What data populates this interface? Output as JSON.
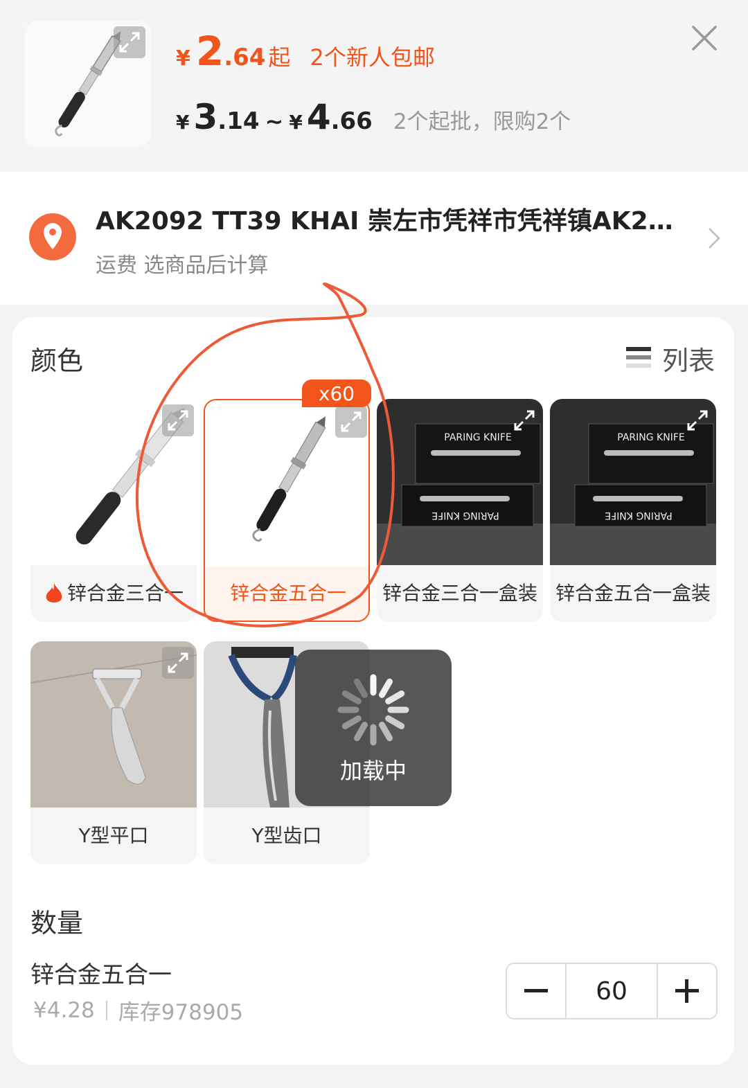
{
  "header": {
    "yen_symbol": "¥",
    "start_price_int": "2",
    "start_price_dec": ".64",
    "start_suffix": "起",
    "promo": "2个新人包邮",
    "range_low_int": "3",
    "range_low_dec": ".14",
    "range_sep": "~",
    "range_high_int": "4",
    "range_high_dec": ".66",
    "limit_text": "2个起批，限购2个"
  },
  "address": {
    "text": "AK2092 TT39 KHAI 崇左市凭祥市凭祥镇AK20…",
    "shipping": "运费 选商品后计算"
  },
  "color_section": {
    "title": "颜色",
    "list_toggle": "列表",
    "selected_badge": "x60",
    "items": [
      {
        "label": "锌合金三合一",
        "hot": true
      },
      {
        "label": "锌合金五合一",
        "selected": true
      },
      {
        "label": "锌合金三合一盒装"
      },
      {
        "label": "锌合金五合一盒装"
      },
      {
        "label": "Y型平口"
      },
      {
        "label": "Y型齿口"
      }
    ],
    "box_print": "PARING KNIFE"
  },
  "loading": {
    "text": "加载中"
  },
  "quantity": {
    "title": "数量",
    "variant_name": "锌合金五合一",
    "variant_price": "¥4.28",
    "stock": "库存978905",
    "value": "60"
  },
  "colors": {
    "accent": "#f2541b",
    "annotation": "#ee5a38"
  }
}
